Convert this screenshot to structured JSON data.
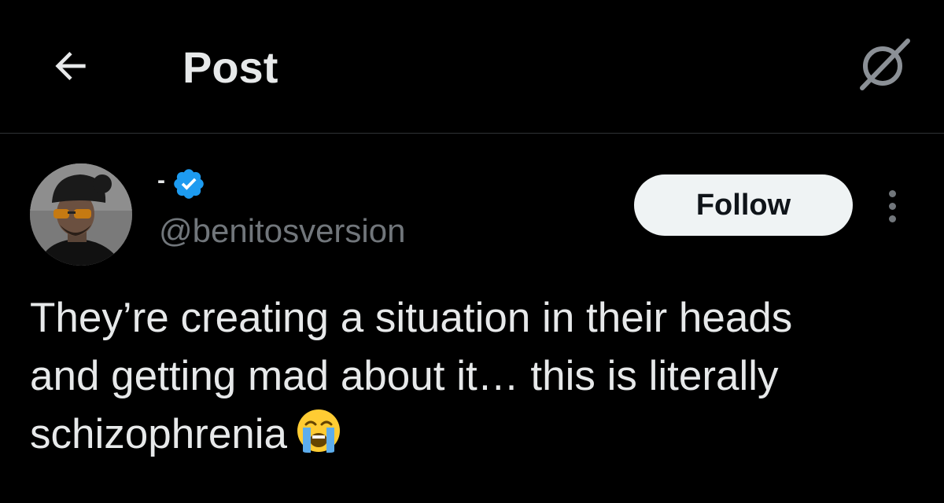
{
  "header": {
    "back_icon": "arrow-left-icon",
    "title": "Post",
    "grok_icon": "grok-icon"
  },
  "author": {
    "display_name": "-",
    "verified_icon": "verified-badge-icon",
    "verified_color": "#1d9bf0",
    "handle": "@benitosversion",
    "follow_label": "Follow",
    "more_icon": "more-vertical-icon"
  },
  "tweet": {
    "line1": "They’re creating a situation in their heads",
    "line2": "and getting mad about it… this is literally",
    "line3": "schizophrenia",
    "emoji": "loudly-crying-face-emoji"
  },
  "colors": {
    "background": "#000000",
    "text_primary": "#e7e9ea",
    "text_secondary": "#71767b",
    "divider": "#2f3336",
    "follow_bg": "#eff3f4",
    "follow_text": "#0f1419"
  }
}
